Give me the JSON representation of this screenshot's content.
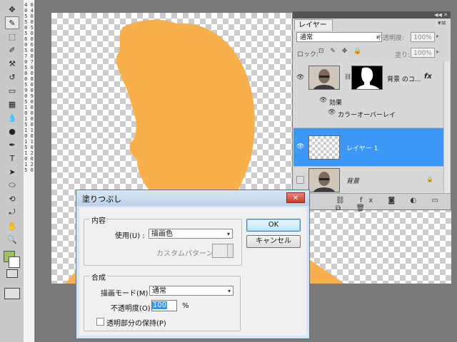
{
  "toolbar": {
    "tools": [
      {
        "name": "move-tool-icon",
        "glyph": "✥"
      },
      {
        "name": "eyedropper-tool-icon",
        "glyph": "✎",
        "active": true
      },
      {
        "name": "marquee-tool-icon",
        "glyph": "⬚"
      },
      {
        "name": "brush-tool-icon",
        "glyph": "✐"
      },
      {
        "name": "clone-stamp-tool-icon",
        "glyph": "⚒"
      },
      {
        "name": "history-brush-tool-icon",
        "glyph": "↺"
      },
      {
        "name": "eraser-tool-icon",
        "glyph": "▭"
      },
      {
        "name": "gradient-tool-icon",
        "glyph": "▦"
      },
      {
        "name": "blur-tool-icon",
        "glyph": "💧"
      },
      {
        "name": "dodge-tool-icon",
        "glyph": "●"
      },
      {
        "name": "pen-tool-icon",
        "glyph": "✒"
      },
      {
        "name": "type-tool-icon",
        "glyph": "T"
      },
      {
        "name": "path-selection-tool-icon",
        "glyph": "➤"
      },
      {
        "name": "shape-tool-icon",
        "glyph": "⬭"
      },
      {
        "name": "3d-rotate-tool-icon",
        "glyph": "⟲"
      },
      {
        "name": "3d-orbit-tool-icon",
        "glyph": "⤾"
      },
      {
        "name": "hand-tool-icon",
        "glyph": "✋"
      },
      {
        "name": "zoom-tool-icon",
        "glyph": "🔍"
      }
    ],
    "foreground_color": "#9cc05f",
    "background_color": "#ffffff"
  },
  "ruler": {
    "digits": "4 0 0 4 5 0 5 0 0 5 5 0 6 0 0 6 5 0 7 0 0 7 5 0 8 0 0 8 5 0 9 0 0 9 5 0 1 0 0 0 1 0 5 0 1 1 0 0 1 1 5 0 1 2 0 0 1 2 5 0"
  },
  "canvas": {
    "silhouette_color": "#f8b04c"
  },
  "layers_panel": {
    "tab_label": "レイヤー",
    "header_icons": "◀◀ ✕",
    "menu_icon": "▾≡",
    "blend_mode": "通常",
    "opacity_label": "不透明度:",
    "opacity_value": "100%",
    "lock_label": "ロック:",
    "lock_icons": "⊡ ✎ ✥ 🔒",
    "fill_label": "塗り:",
    "fill_value": "100%",
    "layers": [
      {
        "name": "背景 のコ...",
        "fx": "fx",
        "effects_label": "効果",
        "effect_name": "カラーオーバーレイ",
        "selected": false
      },
      {
        "name": "レイヤー 1",
        "selected": true
      },
      {
        "name": "背景",
        "locked": true,
        "selected": false
      }
    ],
    "footer_icons": "⛓ fx ◙ ◐ ▭ ⧉ 🗑"
  },
  "fill_dialog": {
    "title": "塗りつぶし",
    "close_glyph": "✕",
    "contents_legend": "内容",
    "use_label": "使用(U) :",
    "use_value": "描画色",
    "custom_pattern_label": "カスタムパターン :",
    "blending_legend": "合成",
    "mode_label": "描画モード(M) :",
    "mode_value": "通常",
    "opacity_label": "不透明度(O) :",
    "opacity_value": "100",
    "opacity_unit": "%",
    "preserve_transparency_label": "透明部分の保持(P)",
    "ok_label": "OK",
    "cancel_label": "キャンセル",
    "dropdown_glyph": "▾"
  }
}
